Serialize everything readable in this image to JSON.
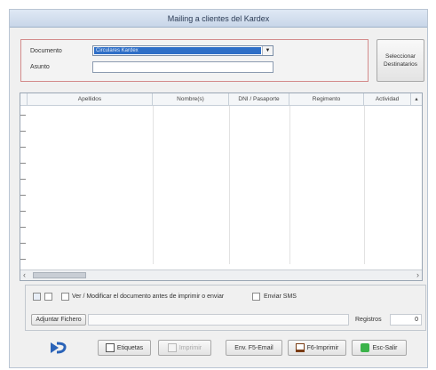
{
  "window": {
    "title": "Mailing a clientes del Kardex"
  },
  "form": {
    "documento_label": "Documento",
    "documento_value": "Circulares Kardex",
    "asunto_label": "Asunto",
    "asunto_value": "",
    "select_button": "Seleccionar Destinatarios"
  },
  "grid": {
    "columns": [
      "Apellidos",
      "Nombre(s)",
      "DNI / Pasaporte",
      "Regimento",
      "Actividad"
    ],
    "scroll_up": "▴",
    "scroll_left": "‹",
    "scroll_right": "›"
  },
  "options": {
    "modify_label": "Ver / Modificar el documento antes de imprimir o enviar",
    "sms_label": "Enviar SMS",
    "attach_button": "Adjuntar Fichero",
    "registros_label": "Registros",
    "registros_value": "0"
  },
  "toolbar": {
    "etiquetas": "Etiquetas",
    "imprimir": "Imprimir",
    "email": "Env. F5-Email",
    "imprimir_f6": "F6-Imprimir",
    "salir": "Esc-Salir"
  }
}
